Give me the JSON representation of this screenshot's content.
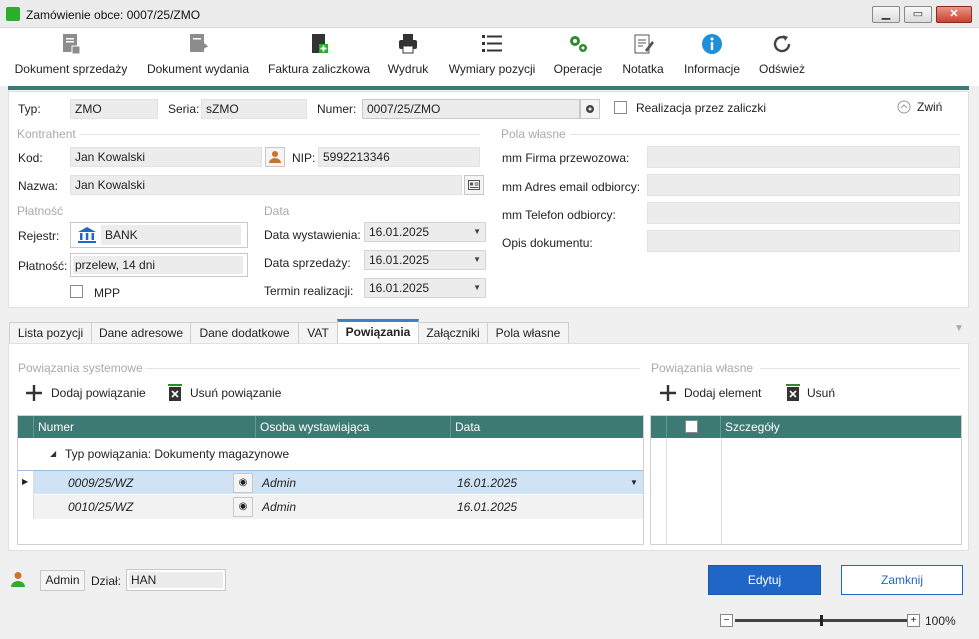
{
  "window": {
    "title": "Zamówienie obce: 0007/25/ZMO",
    "minimize": "▁",
    "maximize": "▭",
    "close": "✕"
  },
  "toolbar": {
    "items": [
      {
        "label": "Dokument sprzedaży",
        "icon": "document-sale-icon"
      },
      {
        "label": "Dokument wydania",
        "icon": "document-release-icon"
      },
      {
        "label": "Faktura zaliczkowa",
        "icon": "invoice-advance-icon"
      },
      {
        "label": "Wydruk",
        "icon": "printer-icon"
      },
      {
        "label": "Wymiary pozycji",
        "icon": "list-icon"
      },
      {
        "label": "Operacje",
        "icon": "gears-icon"
      },
      {
        "label": "Notatka",
        "icon": "note-icon"
      },
      {
        "label": "Informacje",
        "icon": "info-icon"
      },
      {
        "label": "Odśwież",
        "icon": "refresh-icon"
      }
    ]
  },
  "header": {
    "typ_label": "Typ:",
    "typ_value": "ZMO",
    "seria_label": "Seria:",
    "seria_value": "sZMO",
    "numer_label": "Numer:",
    "numer_value": "0007/25/ZMO",
    "realizacja_label": "Realizacja przez zaliczki",
    "zwin_label": "Zwiń"
  },
  "kontrahent": {
    "section": "Kontrahent",
    "kod_label": "Kod:",
    "kod_value": "Jan Kowalski",
    "nip_label": "NIP:",
    "nip_value": "5992213346",
    "nazwa_label": "Nazwa:",
    "nazwa_value": "Jan Kowalski"
  },
  "platnosc": {
    "section": "Płatność",
    "rejestr_label": "Rejestr:",
    "rejestr_value": "BANK",
    "platnosc_label": "Płatność:",
    "platnosc_value": "przelew, 14 dni",
    "mpp_label": "MPP"
  },
  "data": {
    "section": "Data",
    "wystawienia_label": "Data wystawienia:",
    "wystawienia_value": "16.01.2025",
    "sprzedazy_label": "Data sprzedaży:",
    "sprzedazy_value": "16.01.2025",
    "termin_label": "Termin realizacji:",
    "termin_value": "16.01.2025"
  },
  "pola_wlasne": {
    "section": "Pola własne",
    "firma_label": "mm Firma przewozowa:",
    "email_label": "mm Adres email odbiorcy:",
    "telefon_label": "mm Telefon odbiorcy:",
    "opis_label": "Opis dokumentu:"
  },
  "tabs": [
    {
      "label": "Lista pozycji"
    },
    {
      "label": "Dane adresowe"
    },
    {
      "label": "Dane dodatkowe"
    },
    {
      "label": "VAT"
    },
    {
      "label": "Powiązania"
    },
    {
      "label": "Załączniki"
    },
    {
      "label": "Pola własne"
    }
  ],
  "powiazania_systemowe": {
    "section": "Powiązania systemowe",
    "add_label": "Dodaj powiązanie",
    "remove_label": "Usuń powiązanie",
    "columns": [
      "Numer",
      "Osoba wystawiająca",
      "Data"
    ],
    "group_label": "Typ powiązania: Dokumenty magazynowe",
    "rows": [
      {
        "numer": "0009/25/WZ",
        "osoba": "Admin",
        "data": "16.01.2025"
      },
      {
        "numer": "0010/25/WZ",
        "osoba": "Admin",
        "data": "16.01.2025"
      }
    ]
  },
  "powiazania_wlasne": {
    "section": "Powiązania własne",
    "add_label": "Dodaj element",
    "remove_label": "Usuń",
    "columns": [
      "Szczegóły"
    ]
  },
  "footer": {
    "user": "Admin",
    "dzial_label": "Dział:",
    "dzial_value": "HAN",
    "edit_label": "Edytuj",
    "close_label": "Zamknij",
    "zoom": "100%",
    "zoom_level": 1.0
  },
  "colors": {
    "accent": "#3d7a74",
    "primary_button": "#1f66c7",
    "active_tab": "#3b82c4"
  }
}
